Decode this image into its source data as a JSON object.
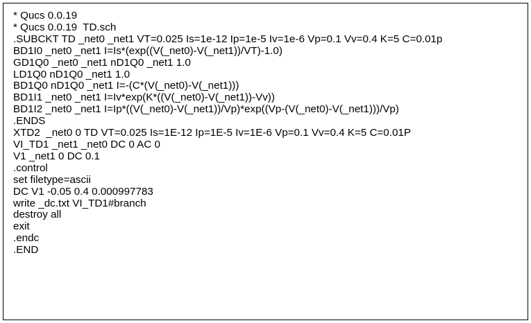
{
  "netlist": {
    "lines": [
      "* Qucs 0.0.19",
      "* Qucs 0.0.19  TD.sch",
      ".SUBCKT TD _net0 _net1 VT=0.025 Is=1e-12 Ip=1e-5 Iv=1e-6 Vp=0.1 Vv=0.4 K=5 C=0.01p",
      "BD1I0 _net0 _net1 I=Is*(exp((V(_net0)-V(_net1))/VT)-1.0)",
      "GD1Q0 _net0 _net1 nD1Q0 _net1 1.0",
      "LD1Q0 nD1Q0 _net1 1.0",
      "BD1Q0 nD1Q0 _net1 I=-(C*(V(_net0)-V(_net1)))",
      "BD1I1 _net0 _net1 I=Iv*exp(K*((V(_net0)-V(_net1))-Vv))",
      "BD1I2 _net0 _net1 I=Ip*((V(_net0)-V(_net1))/Vp)*exp((Vp-(V(_net0)-V(_net1)))/Vp)",
      ".ENDS",
      "XTD2  _net0 0 TD VT=0.025 Is=1E-12 Ip=1E-5 Iv=1E-6 Vp=0.1 Vv=0.4 K=5 C=0.01P",
      "VI_TD1 _net1 _net0 DC 0 AC 0",
      "V1 _net1 0 DC 0.1",
      ".control",
      "set filetype=ascii",
      "DC V1 -0.05 0.4 0.000997783",
      "write _dc.txt VI_TD1#branch",
      "destroy all",
      "exit",
      ".endc",
      ".END"
    ]
  }
}
